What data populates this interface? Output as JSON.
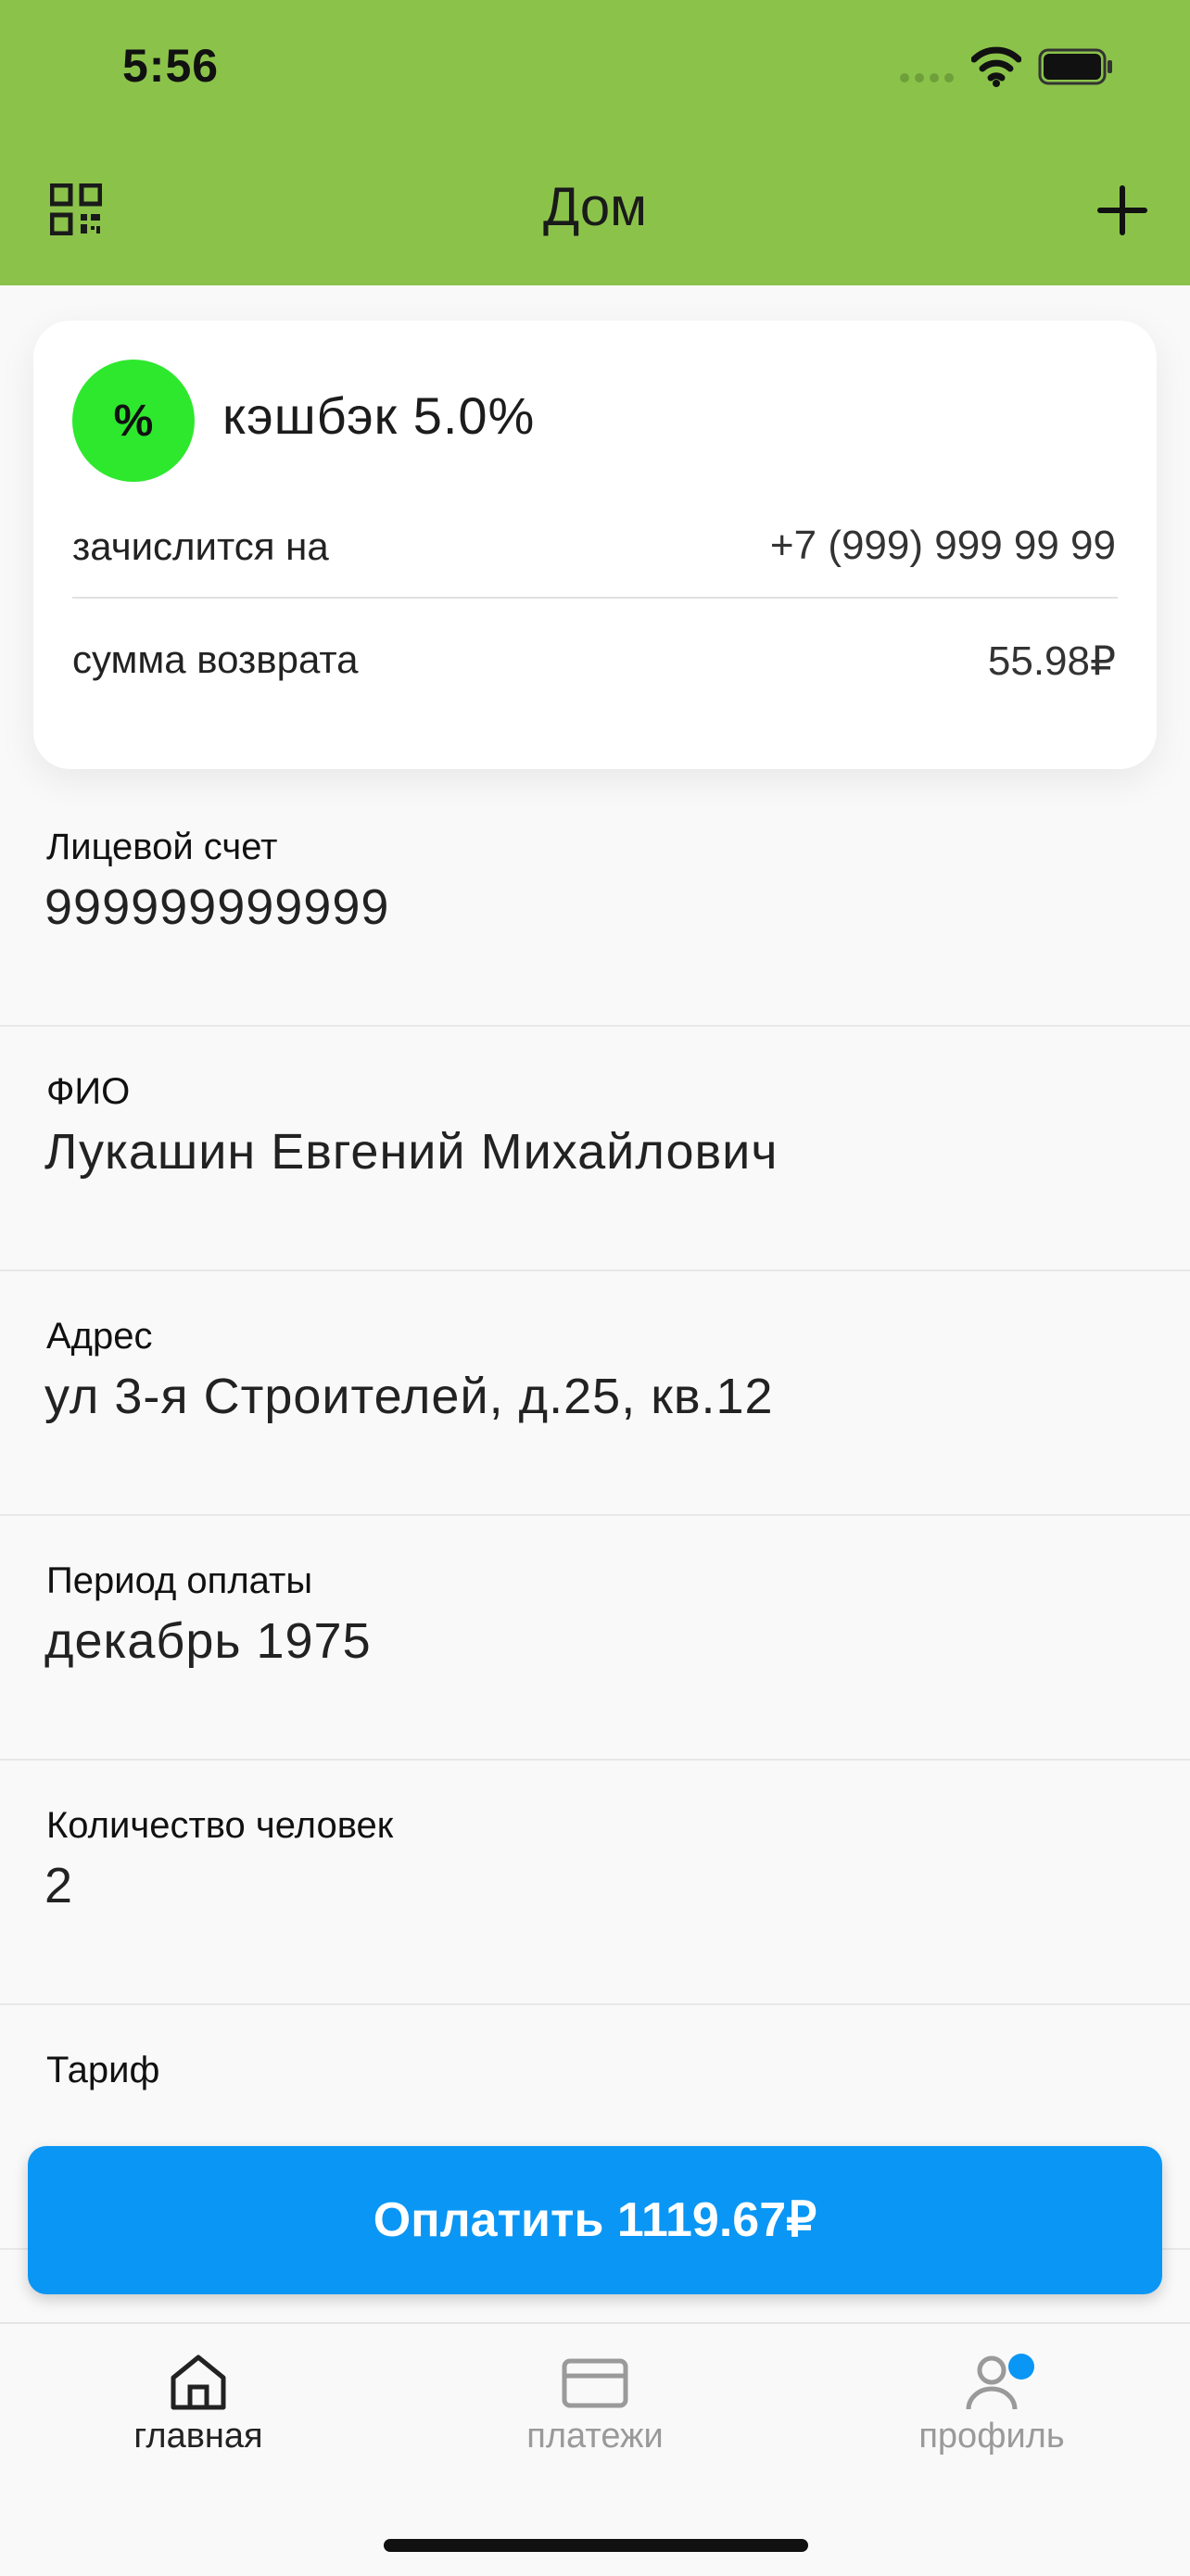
{
  "status_bar": {
    "time": "5:56"
  },
  "header": {
    "title": "Дом"
  },
  "cashback": {
    "badge": "%",
    "title": "кэшбэк 5.0%",
    "rows": [
      {
        "label": "зачислится на",
        "value": "+7 (999) 999 99 99"
      },
      {
        "label": "сумма возврата",
        "value": "55.98₽"
      }
    ]
  },
  "info": [
    {
      "label": "Лицевой счет",
      "value": "999999999999"
    },
    {
      "label": "ФИО",
      "value": "Лукашин Евгений Михайлович"
    },
    {
      "label": "Адрес",
      "value": "ул 3-я Строителей, д.25, кв.12"
    },
    {
      "label": "Период оплаты",
      "value": "декабрь 1975"
    },
    {
      "label": "Количество человек",
      "value": "2"
    },
    {
      "label": "Тариф",
      "value": ""
    }
  ],
  "pay_button": {
    "label": "Оплатить 1119.67₽"
  },
  "tabbar": {
    "items": [
      {
        "label": "главная",
        "icon": "home-icon",
        "active": true
      },
      {
        "label": "платежи",
        "icon": "card-icon",
        "active": false
      },
      {
        "label": "профиль",
        "icon": "profile-icon",
        "active": false,
        "badge": true
      }
    ]
  },
  "colors": {
    "header": "#8bc34a",
    "badge": "#2ee82e",
    "accent": "#0a96f5"
  }
}
